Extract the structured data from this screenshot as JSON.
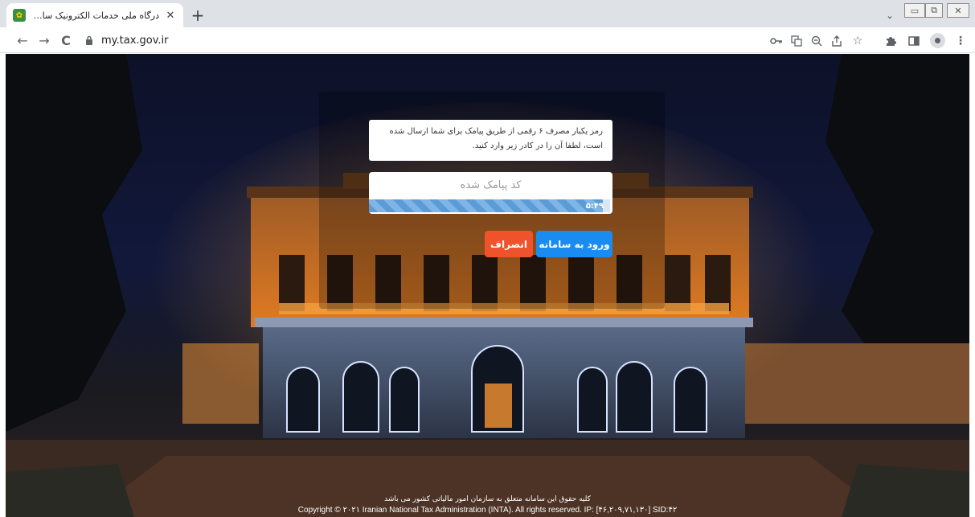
{
  "browser": {
    "tab_title": "درگاه ملی خدمات الکترونیک سازمان امور ...",
    "tab_close": "✕",
    "new_tab": "+",
    "url": "my.tax.gov.ir",
    "window_controls": {
      "minimize": "▭",
      "maximize": "⧉",
      "close": "✕"
    }
  },
  "toolbar": {
    "back": "←",
    "forward": "→",
    "reload": "C",
    "icons": [
      "key-icon",
      "translate-icon",
      "zoom-icon",
      "share-icon",
      "star-icon",
      "extensions-icon",
      "side-panel-icon",
      "profile-icon",
      "menu-icon"
    ]
  },
  "otp": {
    "message": "رمز یکبار مصرف ۶ رقمی از طریق پیامک برای شما ارسال شده است، لطفا آن را در کادر زیر وارد کنید.",
    "placeholder": "کد پیامک شده",
    "timer": "۵:۴۹",
    "timer_fraction": 0.97
  },
  "buttons": {
    "login": "ورود به سامانه",
    "cancel": "انصراف"
  },
  "colors": {
    "login": "#1a8bf0",
    "cancel": "#f0522b",
    "timer": "#5c9cd6"
  },
  "footer": {
    "rights_fa": "کلیه حقوق این سامانه متعلق به سازمان امور مالیاتی کشور می باشد",
    "copyright": "Copyright © ۲۰۲۱ Iranian National Tax Administration (INTA). All rights reserved. IP: [۴۶,۲۰۹,۷۱,۱۳۰] SID:۴۲"
  }
}
